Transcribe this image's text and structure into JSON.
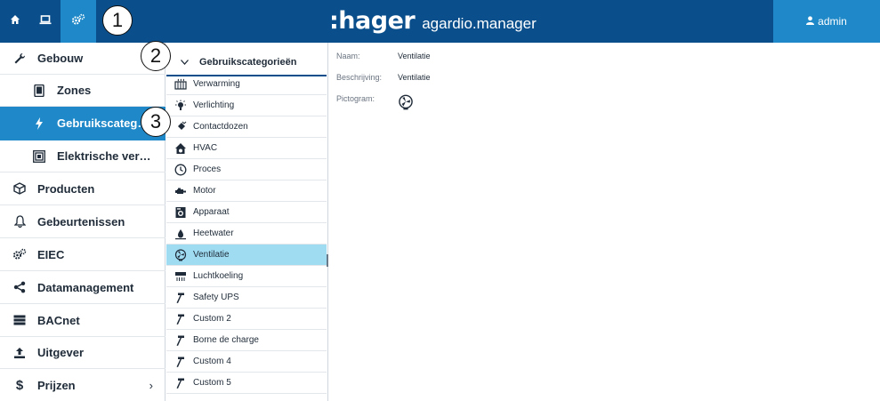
{
  "topbar": {
    "tabs": [
      {
        "icon": "home-icon"
      },
      {
        "icon": "laptop-icon"
      },
      {
        "icon": "cogs-icon"
      }
    ],
    "brand": {
      "logo": ":hager",
      "product": "agardio.manager"
    },
    "user": {
      "icon": "user-icon",
      "name": "admin"
    },
    "colors": {
      "bar": "#0a4f8c",
      "accent": "#1e88c8",
      "selected_row": "#9fdcf2"
    }
  },
  "leftnav": {
    "items": [
      {
        "label": "Gebouw",
        "icon": "wrench-icon"
      },
      {
        "label": "Zones",
        "icon": "tablet-icon"
      },
      {
        "label": "Gebruikscateg…",
        "icon": "bolt-icon",
        "active": true
      },
      {
        "label": "Elektrische ver…",
        "icon": "panel-icon"
      },
      {
        "label": "Producten",
        "icon": "cube-icon"
      },
      {
        "label": "Gebeurtenissen",
        "icon": "bell-icon"
      },
      {
        "label": "EIEC",
        "icon": "cogs-icon"
      },
      {
        "label": "Datamanagement",
        "icon": "share-icon"
      },
      {
        "label": "BACnet",
        "icon": "server-icon"
      },
      {
        "label": "Uitgever",
        "icon": "upload-icon"
      },
      {
        "label": "Prijzen",
        "icon": "dollar-icon",
        "chevron": "›"
      }
    ]
  },
  "categories": {
    "header": "Gebruikscategorieën",
    "items": [
      {
        "label": "Verwarming",
        "icon": "radiator-icon"
      },
      {
        "label": "Verlichting",
        "icon": "bulb-icon"
      },
      {
        "label": "Contactdozen",
        "icon": "plug-icon"
      },
      {
        "label": "HVAC",
        "icon": "house-icon"
      },
      {
        "label": "Proces",
        "icon": "clock-icon"
      },
      {
        "label": "Motor",
        "icon": "motor-icon"
      },
      {
        "label": "Apparaat",
        "icon": "appliance-icon"
      },
      {
        "label": "Heetwater",
        "icon": "drop-icon"
      },
      {
        "label": "Ventilatie",
        "icon": "fan-icon",
        "selected": true
      },
      {
        "label": "Luchtkoeling",
        "icon": "aircon-icon"
      },
      {
        "label": "Safety UPS",
        "icon": "hammer-icon"
      },
      {
        "label": "Custom 2",
        "icon": "hammer-icon"
      },
      {
        "label": "Borne de charge",
        "icon": "hammer-icon"
      },
      {
        "label": "Custom 4",
        "icon": "hammer-icon"
      },
      {
        "label": "Custom 5",
        "icon": "hammer-icon"
      }
    ]
  },
  "details": {
    "name_label": "Naam:",
    "name_value": "Ventilatie",
    "description_label": "Beschrijving:",
    "description_value": "Ventilatie",
    "pictogram_label": "Pictogram:",
    "pictogram_icon": "fan-icon"
  },
  "callouts": [
    "1",
    "2",
    "3"
  ]
}
